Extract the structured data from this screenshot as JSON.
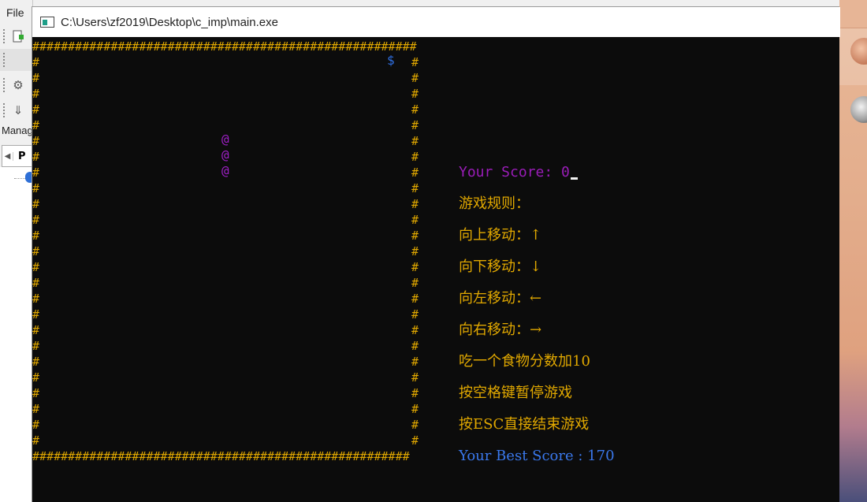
{
  "ide": {
    "menu_file": "File",
    "panel_label": "Manag",
    "tab_letter": "P"
  },
  "window": {
    "title": "C:\\Users\\zf2019\\Desktop\\c_imp\\main.exe"
  },
  "game": {
    "wall_char": "#",
    "food_char": "$",
    "snake_char": "@",
    "score_label": "Your Score: ",
    "score_value": "0",
    "rules": [
      "游戏规则：",
      "向上移动：↑",
      "向下移动：↓",
      "向左移动：←",
      "向右移动：→",
      "吃一个食物分数加10",
      "按空格键暂停游戏",
      "按ESC直接结束游戏"
    ],
    "best_score_text": "Your Best Score : 170"
  },
  "colors": {
    "wall": "#e1a800",
    "snake": "#a020c8",
    "food": "#2f6fe2",
    "score": "#9a1db8",
    "best_score": "#3a78ec",
    "console_bg": "#0c0c0c"
  }
}
